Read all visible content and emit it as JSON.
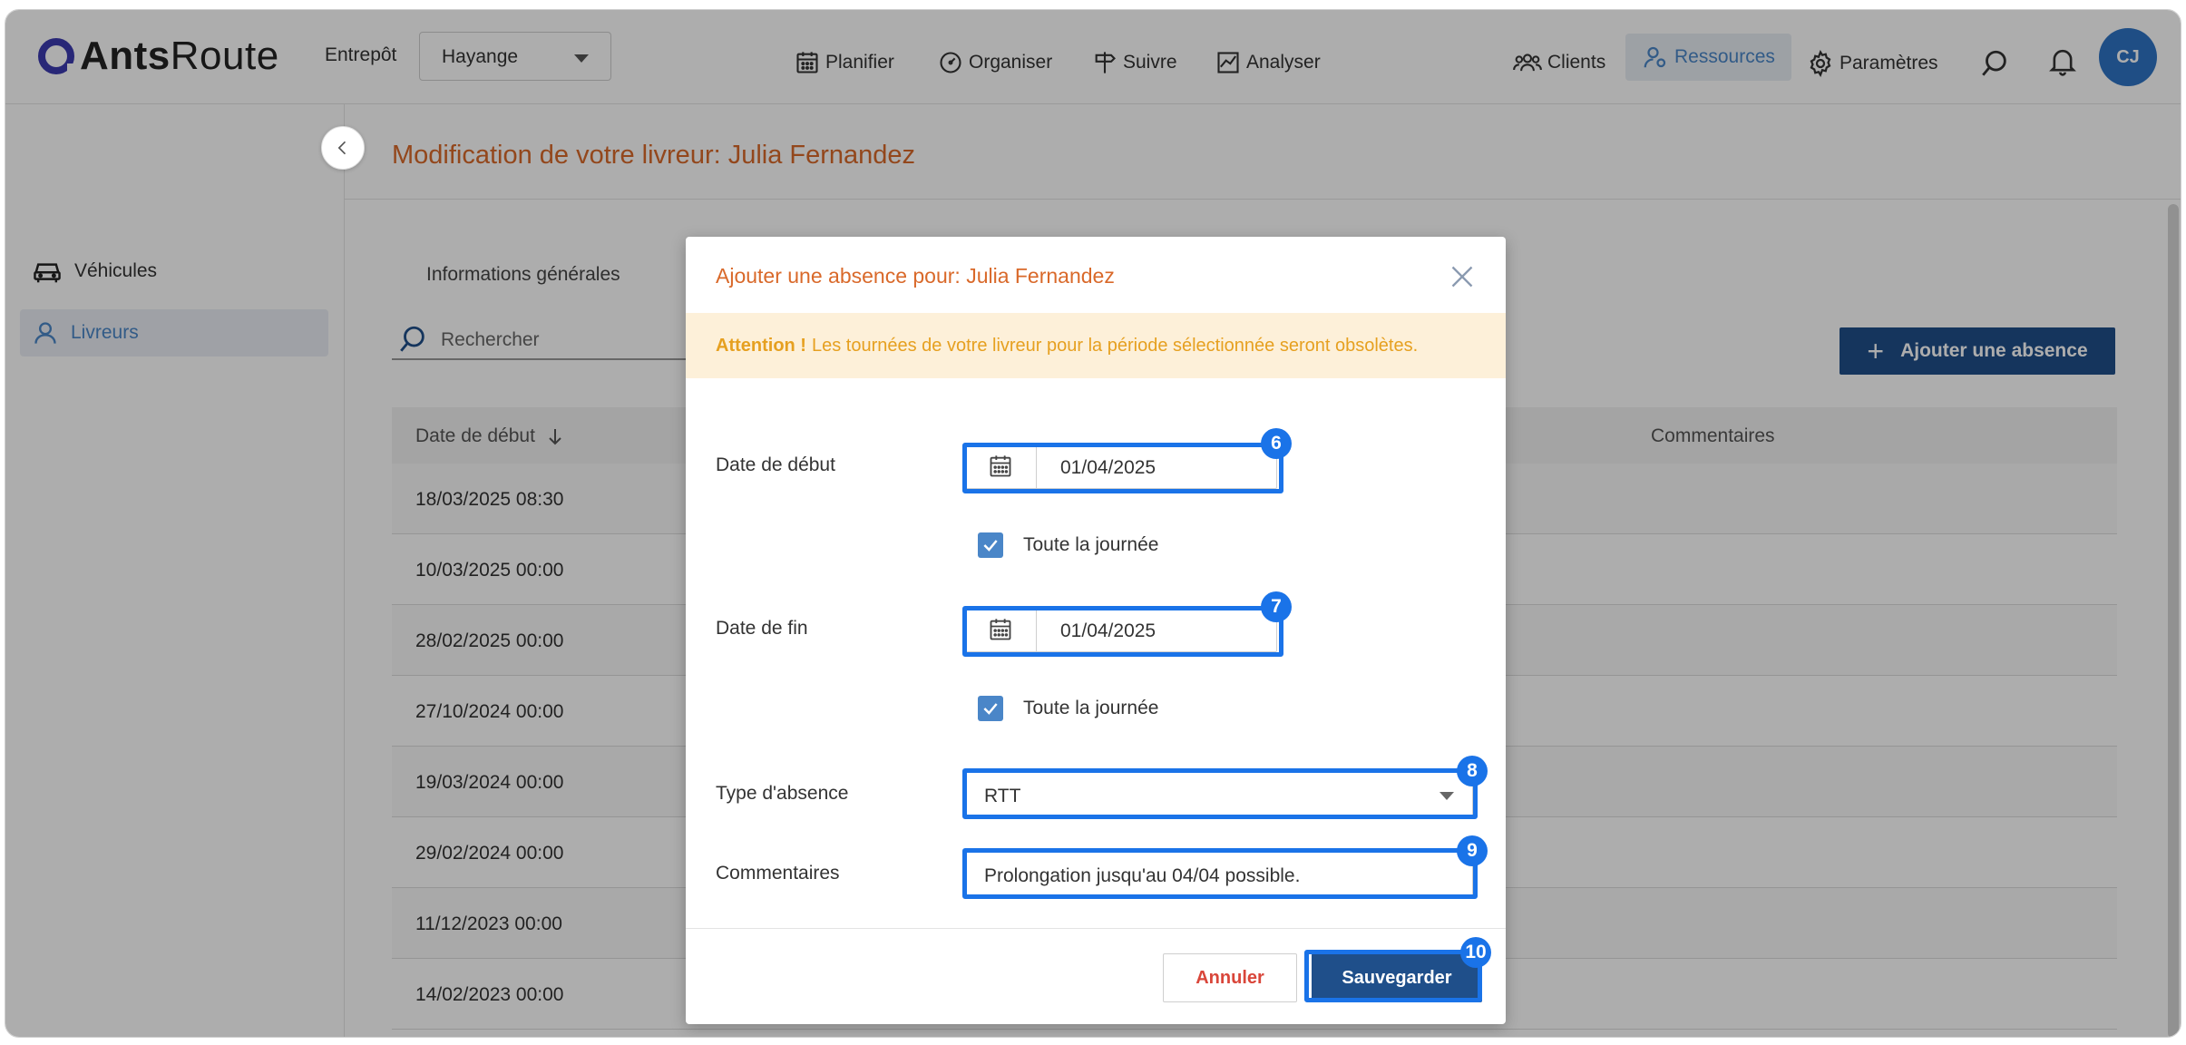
{
  "header": {
    "logo_bold": "Ants",
    "logo_light": "Route",
    "warehouse_label": "Entrepôt",
    "warehouse_value": "Hayange",
    "nav": [
      {
        "label": "Planifier",
        "icon": "calendar-icon"
      },
      {
        "label": "Organiser",
        "icon": "gauge-icon"
      },
      {
        "label": "Suivre",
        "icon": "signpost-icon"
      },
      {
        "label": "Analyser",
        "icon": "chart-icon"
      }
    ],
    "right_nav": [
      {
        "label": "Clients",
        "icon": "users-icon"
      },
      {
        "label": "Ressources",
        "icon": "user-gear-icon",
        "active": true
      },
      {
        "label": "Paramètres",
        "icon": "gear-icon"
      }
    ],
    "avatar_initials": "CJ"
  },
  "sidebar": {
    "items": [
      {
        "label": "Véhicules",
        "icon": "car-icon"
      },
      {
        "label": "Livreurs",
        "icon": "person-icon",
        "active": true
      }
    ]
  },
  "main": {
    "page_title": "Modification de votre livreur: Julia Fernandez",
    "tab_general": "Informations générales",
    "search_placeholder": "Rechercher",
    "add_button": "Ajouter une absence",
    "table": {
      "col_start": "Date de début",
      "col_comments": "Commentaires",
      "rows": [
        "18/03/2025 08:30",
        "10/03/2025 00:00",
        "28/02/2025 00:00",
        "27/10/2024 00:00",
        "19/03/2024 00:00",
        "29/02/2024 00:00",
        "11/12/2023 00:00",
        "14/02/2023 00:00"
      ]
    }
  },
  "modal": {
    "title": "Ajouter une absence pour: Julia Fernandez",
    "warning_strong": "Attention !",
    "warning_text": "Les tournées de votre livreur pour la période sélectionnée seront obsolètes.",
    "start_label": "Date de début",
    "start_value": "01/04/2025",
    "start_all_day": "Toute la journée",
    "end_label": "Date de fin",
    "end_value": "01/04/2025",
    "end_all_day": "Toute la journée",
    "type_label": "Type d'absence",
    "type_value": "RTT",
    "comment_label": "Commentaires",
    "comment_value": "Prolongation jusqu'au 04/04 possible.",
    "cancel": "Annuler",
    "save": "Sauvegarder"
  },
  "annotations": [
    "6",
    "7",
    "8",
    "9",
    "10"
  ],
  "colors": {
    "accent": "#d9692a",
    "primary": "#1f4f8a",
    "highlight": "#1a73e8",
    "warning_bg": "#fdf0d9"
  }
}
